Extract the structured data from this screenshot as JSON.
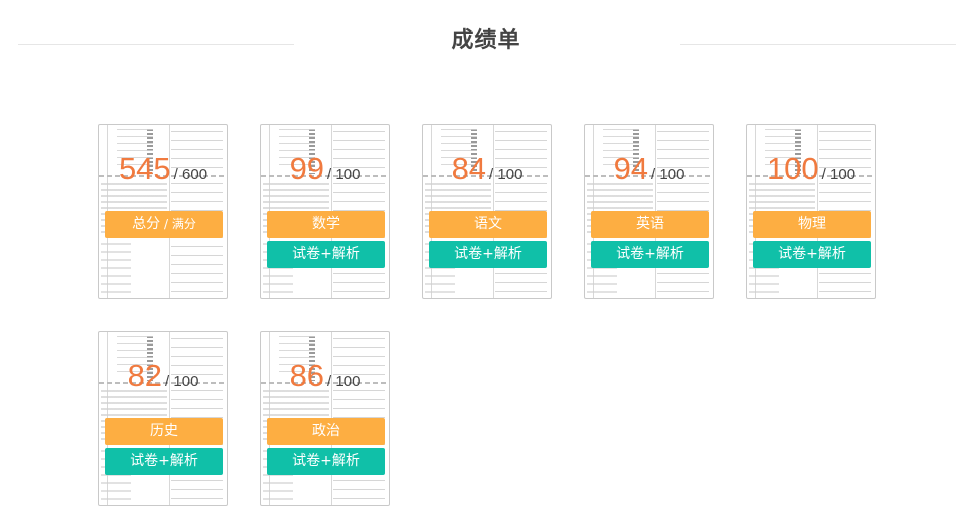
{
  "page": {
    "title": "成绩单"
  },
  "cards": [
    {
      "score": "545",
      "max": "/ 600",
      "subject": "总分",
      "subject_extra": " / 满分",
      "paper": ""
    },
    {
      "score": "99",
      "max": "/ 100",
      "subject": "数学",
      "subject_extra": "",
      "paper": "试卷+解析"
    },
    {
      "score": "84",
      "max": "/ 100",
      "subject": "语文",
      "subject_extra": "",
      "paper": "试卷+解析"
    },
    {
      "score": "94",
      "max": "/ 100",
      "subject": "英语",
      "subject_extra": "",
      "paper": "试卷+解析"
    },
    {
      "score": "100",
      "max": "/ 100",
      "subject": "物理",
      "subject_extra": "",
      "paper": "试卷+解析"
    },
    {
      "score": "82",
      "max": "/ 100",
      "subject": "历史",
      "subject_extra": "",
      "paper": "试卷+解析"
    },
    {
      "score": "86",
      "max": "/ 100",
      "subject": "政治",
      "subject_extra": "",
      "paper": "试卷+解析"
    }
  ],
  "colors": {
    "score": "#f07a3f",
    "subject_button": "#fdae42",
    "paper_button": "#10c0a8",
    "title": "#444444"
  }
}
